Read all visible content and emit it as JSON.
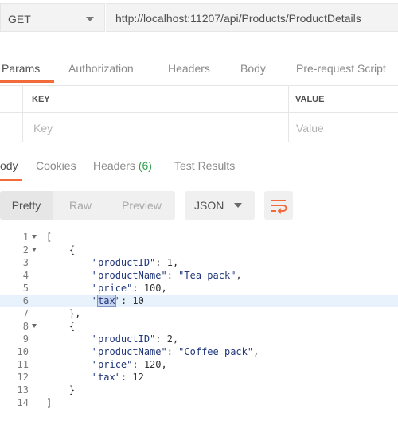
{
  "request": {
    "method": "GET",
    "url": "http://localhost:11207/api/Products/ProductDetails"
  },
  "request_tabs": [
    "Params",
    "Authorization",
    "Headers",
    "Body",
    "Pre-request Script"
  ],
  "params_table": {
    "headers": [
      "KEY",
      "VALUE"
    ],
    "key_placeholder": "Key",
    "value_placeholder": "Value"
  },
  "response_tabs": {
    "body": "ody",
    "cookies": "Cookies",
    "headers": "Headers",
    "headers_count": "(6)",
    "test_results": "Test Results"
  },
  "view_modes": [
    "Pretty",
    "Raw",
    "Preview"
  ],
  "format": "JSON",
  "icons": {
    "wrap": "wrap-lines-icon",
    "method_dropdown": "chevron-down-icon",
    "format_dropdown": "chevron-down-icon"
  },
  "colors": {
    "accent": "#f26b3a",
    "count": "#2e9f4b"
  },
  "code": {
    "line_numbers": [
      "1",
      "2",
      "3",
      "4",
      "5",
      "6",
      "7",
      "8",
      "9",
      "10",
      "11",
      "12",
      "13",
      "14"
    ],
    "lines": {
      "l1": "[",
      "l2": "    {",
      "l3_key": "\"productID\"",
      "l3_val": ": 1,",
      "l4_key": "\"productName\"",
      "l4_sep": ": ",
      "l4_val": "\"Tea pack\"",
      "l4_end": ",",
      "l5_key": "\"price\"",
      "l5_val": ": 100,",
      "l6_q1": "\"",
      "l6_sel": "tax",
      "l6_q2": "\"",
      "l6_val": ": 10",
      "l7": "    },",
      "l8": "    {",
      "l9_key": "\"productID\"",
      "l9_val": ": 2,",
      "l10_key": "\"productName\"",
      "l10_sep": ": ",
      "l10_val": "\"Coffee pack\"",
      "l10_end": ",",
      "l11_key": "\"price\"",
      "l11_val": ": 120,",
      "l12_key": "\"tax\"",
      "l12_val": ": 12",
      "l13": "    }",
      "l14": "]"
    }
  }
}
